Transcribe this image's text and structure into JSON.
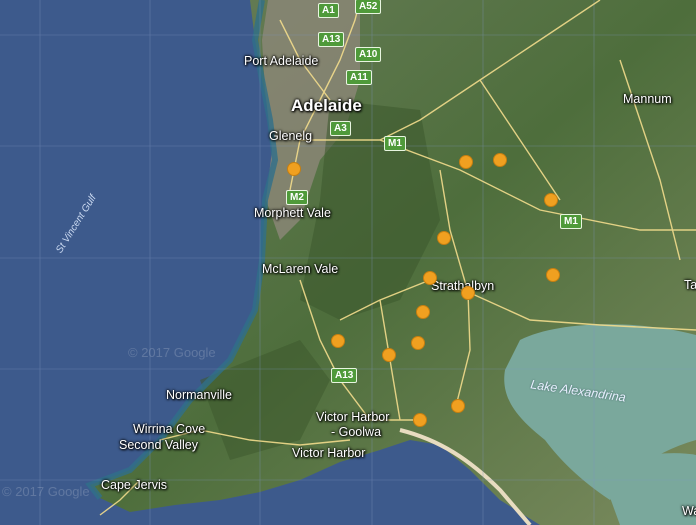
{
  "map": {
    "places": [
      {
        "id": "port-adelaide",
        "name": "Port Adelaide",
        "size": "med"
      },
      {
        "id": "adelaide",
        "name": "Adelaide",
        "size": "big"
      },
      {
        "id": "glenelg",
        "name": "Glenelg",
        "size": "med"
      },
      {
        "id": "morphett-vale",
        "name": "Morphett Vale",
        "size": "med"
      },
      {
        "id": "mclaren-vale",
        "name": "McLaren Vale",
        "size": "med"
      },
      {
        "id": "strathalbyn",
        "name": "Strathalbyn",
        "size": "med"
      },
      {
        "id": "mannum",
        "name": "Mannum",
        "size": "med"
      },
      {
        "id": "normanville",
        "name": "Normanville",
        "size": "med"
      },
      {
        "id": "wirrina-cove",
        "name": "Wirrina Cove",
        "size": "med"
      },
      {
        "id": "second-valley",
        "name": "Second Valley",
        "size": "med"
      },
      {
        "id": "victor-harbor-goolwa-1",
        "name": "Victor Harbor",
        "size": "med"
      },
      {
        "id": "victor-harbor-goolwa-2",
        "name": "- Goolwa",
        "size": "med"
      },
      {
        "id": "victor-harbor",
        "name": "Victor Harbor",
        "size": "med"
      },
      {
        "id": "cape-jervis",
        "name": "Cape Jervis",
        "size": "med"
      }
    ],
    "water_labels": [
      {
        "id": "st-vincent-gulf",
        "name": "St Vincent Gulf"
      },
      {
        "id": "lake-alexandrina",
        "name": "Lake Alexandrina"
      }
    ],
    "road_shields": [
      "A1",
      "A52",
      "A13",
      "A10",
      "A11",
      "A3",
      "M1",
      "M2",
      "M1",
      "A13"
    ],
    "watermarks": [
      "© 2017 Google",
      "© 2017 Google"
    ],
    "marker_count": 14,
    "colors": {
      "ocean": "#3d5a8c",
      "land": "#5d7a48",
      "road": "#f2dc8c",
      "marker": "#f0a020",
      "shield": "#4f9a3a",
      "lake": "#7aa89c"
    },
    "edge_labels": [
      "Ta",
      "Wal"
    ]
  }
}
